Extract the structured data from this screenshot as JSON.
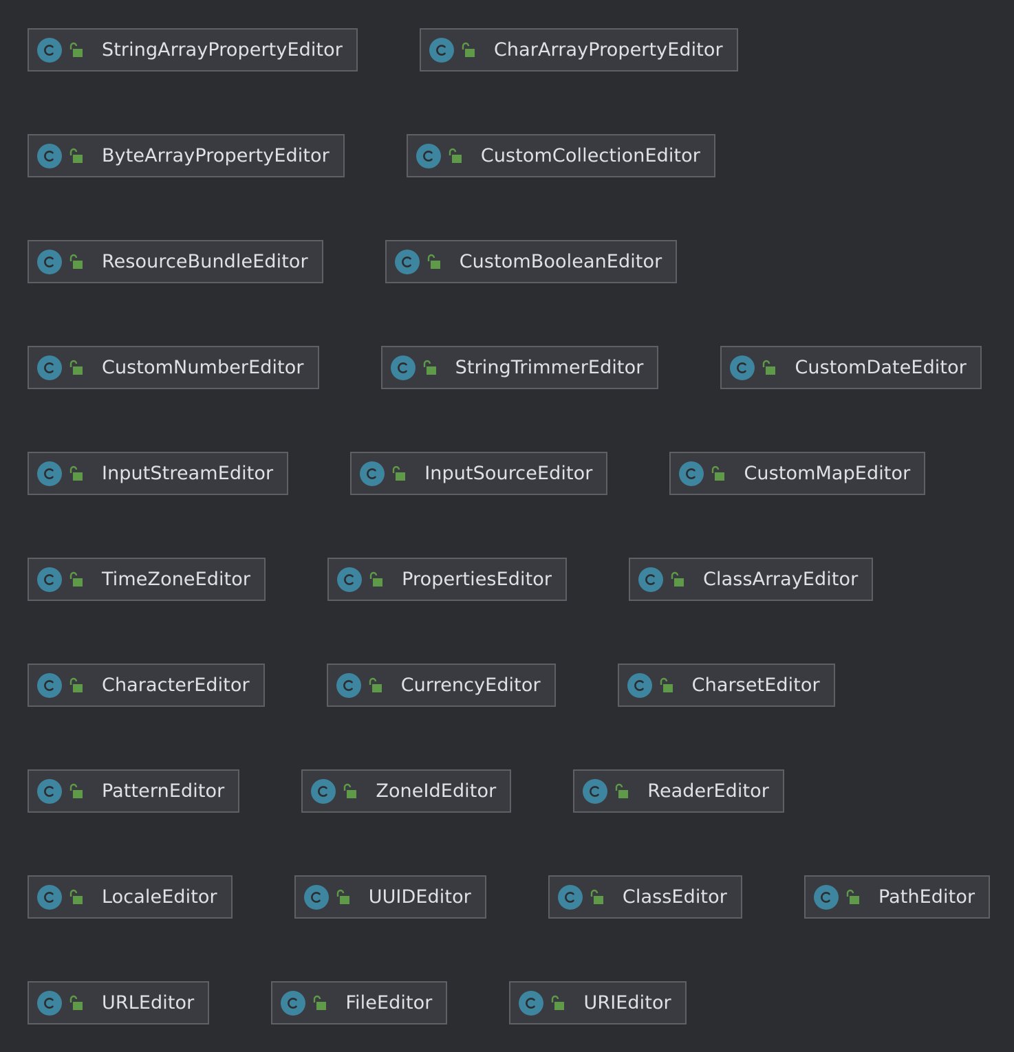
{
  "diagram": {
    "rows": [
      {
        "classes": [
          {
            "name": "StringArrayPropertyEditor",
            "kind_icon": "class-icon",
            "access_icon": "public-icon"
          },
          {
            "name": "CharArrayPropertyEditor",
            "kind_icon": "class-icon",
            "access_icon": "public-icon"
          }
        ]
      },
      {
        "classes": [
          {
            "name": "ByteArrayPropertyEditor",
            "kind_icon": "class-icon",
            "access_icon": "public-icon"
          },
          {
            "name": "CustomCollectionEditor",
            "kind_icon": "class-icon",
            "access_icon": "public-icon"
          }
        ]
      },
      {
        "classes": [
          {
            "name": "ResourceBundleEditor",
            "kind_icon": "class-icon",
            "access_icon": "public-icon"
          },
          {
            "name": "CustomBooleanEditor",
            "kind_icon": "class-icon",
            "access_icon": "public-icon"
          }
        ]
      },
      {
        "classes": [
          {
            "name": "CustomNumberEditor",
            "kind_icon": "class-icon",
            "access_icon": "public-icon"
          },
          {
            "name": "StringTrimmerEditor",
            "kind_icon": "class-icon",
            "access_icon": "public-icon"
          },
          {
            "name": "CustomDateEditor",
            "kind_icon": "class-icon",
            "access_icon": "public-icon"
          }
        ]
      },
      {
        "classes": [
          {
            "name": "InputStreamEditor",
            "kind_icon": "class-icon",
            "access_icon": "public-icon"
          },
          {
            "name": "InputSourceEditor",
            "kind_icon": "class-icon",
            "access_icon": "public-icon"
          },
          {
            "name": "CustomMapEditor",
            "kind_icon": "class-icon",
            "access_icon": "public-icon"
          }
        ]
      },
      {
        "classes": [
          {
            "name": "TimeZoneEditor",
            "kind_icon": "class-icon",
            "access_icon": "public-icon"
          },
          {
            "name": "PropertiesEditor",
            "kind_icon": "class-icon",
            "access_icon": "public-icon"
          },
          {
            "name": "ClassArrayEditor",
            "kind_icon": "class-icon",
            "access_icon": "public-icon"
          }
        ]
      },
      {
        "classes": [
          {
            "name": "CharacterEditor",
            "kind_icon": "class-icon",
            "access_icon": "public-icon"
          },
          {
            "name": "CurrencyEditor",
            "kind_icon": "class-icon",
            "access_icon": "public-icon"
          },
          {
            "name": "CharsetEditor",
            "kind_icon": "class-icon",
            "access_icon": "public-icon"
          }
        ]
      },
      {
        "classes": [
          {
            "name": "PatternEditor",
            "kind_icon": "class-icon",
            "access_icon": "public-icon"
          },
          {
            "name": "ZoneIdEditor",
            "kind_icon": "class-icon",
            "access_icon": "public-icon"
          },
          {
            "name": "ReaderEditor",
            "kind_icon": "class-icon",
            "access_icon": "public-icon"
          }
        ]
      },
      {
        "classes": [
          {
            "name": "LocaleEditor",
            "kind_icon": "class-icon",
            "access_icon": "public-icon"
          },
          {
            "name": "UUIDEditor",
            "kind_icon": "class-icon",
            "access_icon": "public-icon"
          },
          {
            "name": "ClassEditor",
            "kind_icon": "class-icon",
            "access_icon": "public-icon"
          },
          {
            "name": "PathEditor",
            "kind_icon": "class-icon",
            "access_icon": "public-icon"
          }
        ]
      },
      {
        "classes": [
          {
            "name": "URLEditor",
            "kind_icon": "class-icon",
            "access_icon": "public-icon"
          },
          {
            "name": "FileEditor",
            "kind_icon": "class-icon",
            "access_icon": "public-icon"
          },
          {
            "name": "URIEditor",
            "kind_icon": "class-icon",
            "access_icon": "public-icon"
          }
        ]
      }
    ]
  },
  "colors": {
    "background": "#2b2d31",
    "node_fill": "#393b40",
    "node_border": "#5e6064",
    "class_icon": "#3e86a0",
    "public_icon": "#5f9a48",
    "text": "#dfe1e5"
  }
}
